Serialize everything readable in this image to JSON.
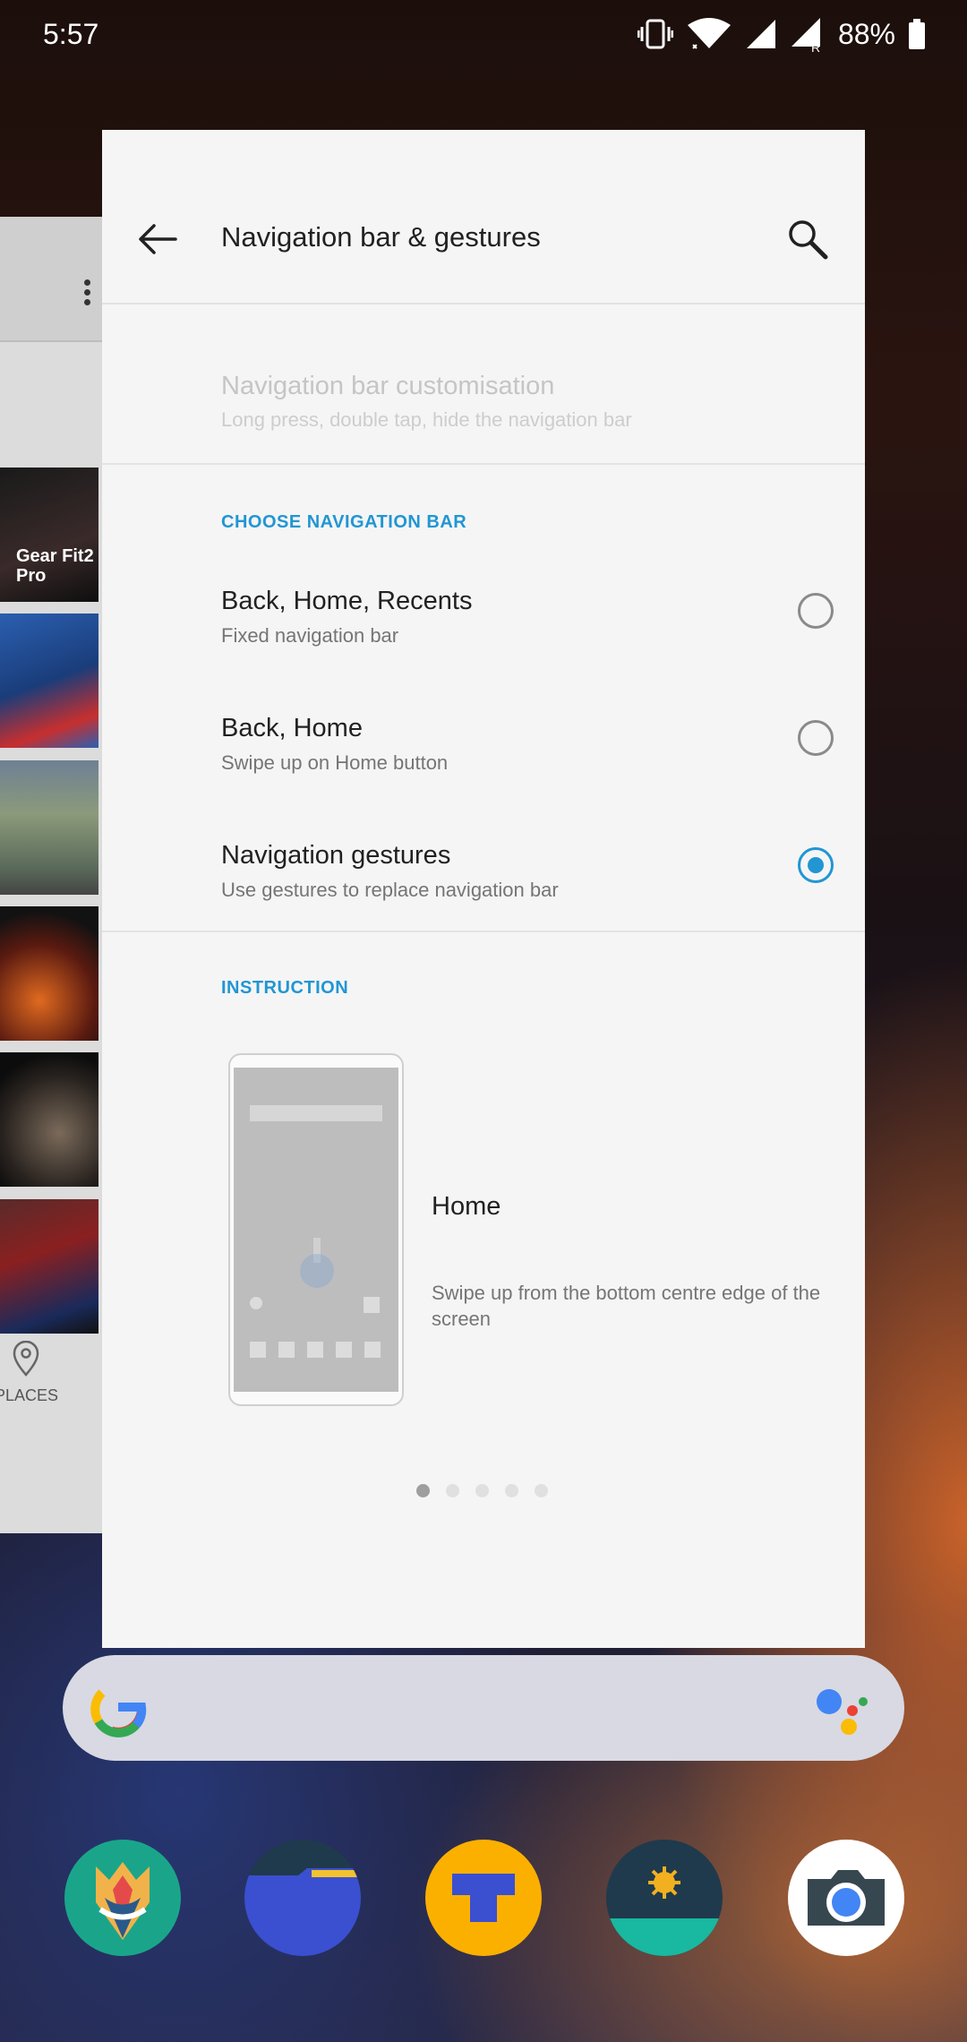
{
  "status_bar": {
    "time": "5:57",
    "battery": "88%",
    "icons": [
      "vibrate-icon",
      "wifi-icon",
      "signal-icon",
      "signal-roaming-icon",
      "battery-icon"
    ]
  },
  "background_app": {
    "thumb_label": "Gear Fit2 Pro",
    "places_label": "PLACES"
  },
  "settings": {
    "title": "Navigation bar & gestures",
    "customisation": {
      "title": "Navigation bar customisation",
      "subtitle": "Long press, double tap, hide the navigation bar"
    },
    "choose_header": "CHOOSE NAVIGATION BAR",
    "options": [
      {
        "title": "Back, Home, Recents",
        "subtitle": "Fixed navigation bar",
        "selected": false
      },
      {
        "title": "Back, Home",
        "subtitle": "Swipe up on Home button",
        "selected": false
      },
      {
        "title": "Navigation gestures",
        "subtitle": "Use gestures to replace navigation bar",
        "selected": true
      }
    ],
    "instruction_header": "INSTRUCTION",
    "instruction": {
      "title": "Home",
      "description": "Swipe up from the bottom centre edge of the screen"
    },
    "pager": {
      "current": 1,
      "total": 5
    }
  },
  "colors": {
    "accent": "#2196d3",
    "panel_bg": "#f5f5f5"
  },
  "dock_apps": [
    "magisk-icon",
    "files-icon",
    "typography-app-icon",
    "weather-icon",
    "camera-icon"
  ]
}
